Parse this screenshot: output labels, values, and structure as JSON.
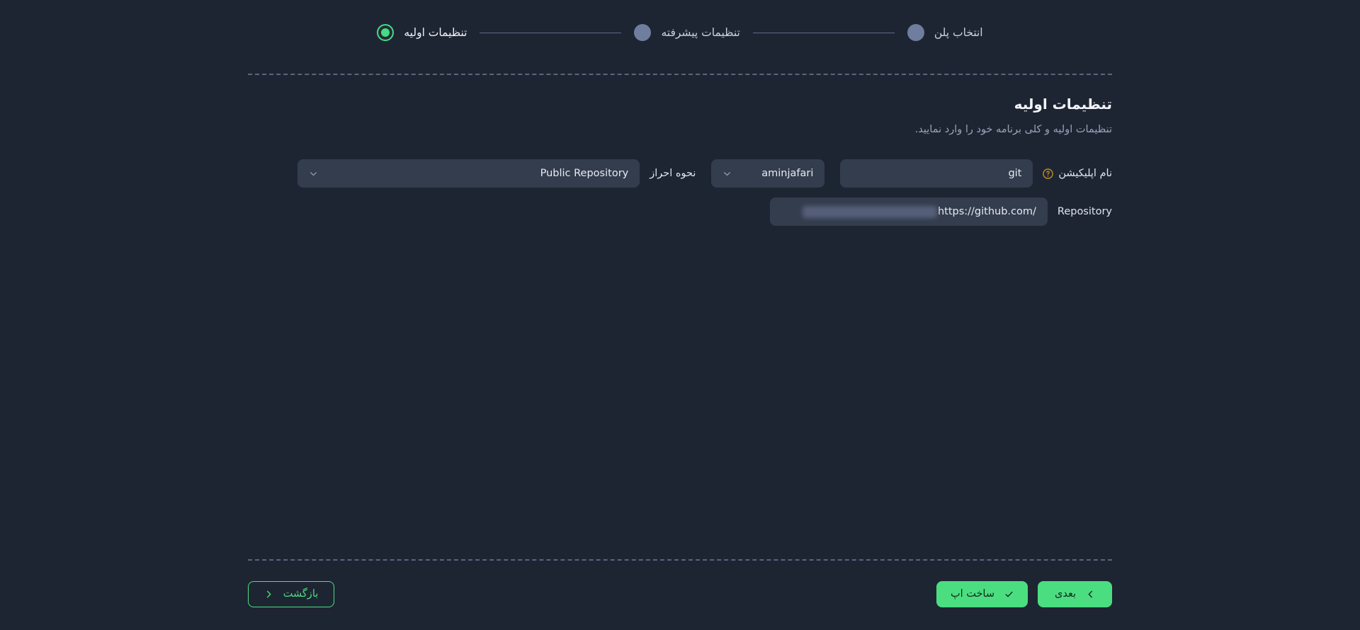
{
  "stepper": {
    "steps": [
      {
        "label": "انتخاب پلن",
        "state": "pending",
        "icon": "step-dot-icon"
      },
      {
        "label": "تنظیمات پیشرفته",
        "state": "pending",
        "icon": "step-dot-icon"
      },
      {
        "label": "تنظیمات اولیه",
        "state": "active",
        "icon": "step-dot-active-icon"
      }
    ]
  },
  "page": {
    "title": "تنظیمات اولیه",
    "subtitle": "تنظیمات اولیه و کلی برنامه خود را وارد نمایید."
  },
  "form": {
    "app_name": {
      "label": "نام اپلیکیشن",
      "help_icon": "question-circle-icon",
      "value": "git",
      "placeholder": "نام اپلیکیشن"
    },
    "account": {
      "value": "aminjafari",
      "chevron": "chevron-down-icon"
    },
    "auth_method": {
      "label": "نحوه احراز",
      "value": "Public Repository",
      "chevron": "chevron-down-icon"
    },
    "repository": {
      "label": "Repository",
      "value": "https://github.com/",
      "redacted": true,
      "placeholder": "https://github.com/"
    }
  },
  "footer": {
    "build_button": {
      "label": "ساخت اپ",
      "icon": "check-icon"
    },
    "next_button": {
      "label": "بعدی",
      "icon": "chevron-left-icon"
    },
    "back_button": {
      "label": "بازگشت",
      "icon": "chevron-right-icon"
    }
  },
  "colors": {
    "background": "#1e2532",
    "surface": "#343d4e",
    "accent_green": "#4ade80",
    "step_pending": "#6f7d9e",
    "help_amber": "#c9951f",
    "divider": "#59657f"
  }
}
